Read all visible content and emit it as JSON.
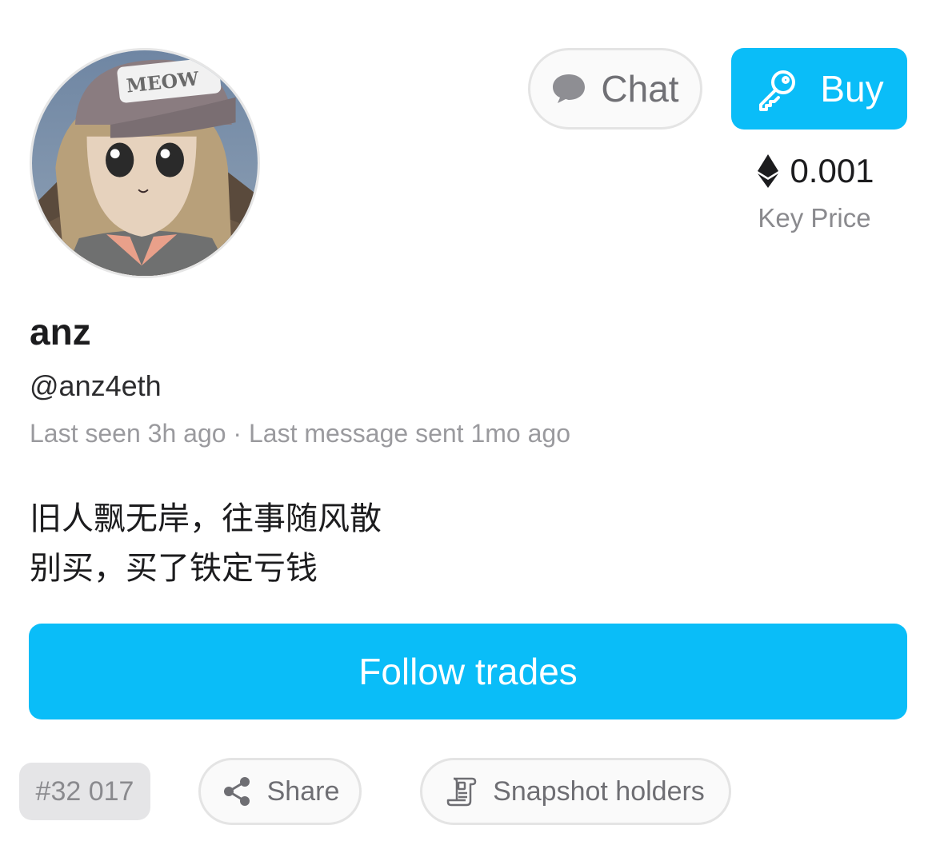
{
  "profile": {
    "name": "anz",
    "handle": "@anz4eth",
    "status": "Last seen 3h ago · Last message sent 1mo ago",
    "bio": [
      "旧人飘无岸，往事随风散",
      "别买，买了铁定亏钱"
    ],
    "avatar_cap_text": "MEOW"
  },
  "actions": {
    "chat_label": "Chat",
    "buy_label": "Buy",
    "follow_label": "Follow trades",
    "share_label": "Share",
    "snapshot_label": "Snapshot holders"
  },
  "price": {
    "value": "0.001",
    "label": "Key Price"
  },
  "rank": "#32 017",
  "colors": {
    "accent": "#0abdf8",
    "muted_text": "#8a8a8e",
    "pill_border": "#e4e4e4"
  },
  "icons": {
    "chat": "speech-bubble-icon",
    "buy": "key-icon",
    "currency": "ethereum-icon",
    "share": "share-icon",
    "snapshot": "scroll-document-icon"
  }
}
